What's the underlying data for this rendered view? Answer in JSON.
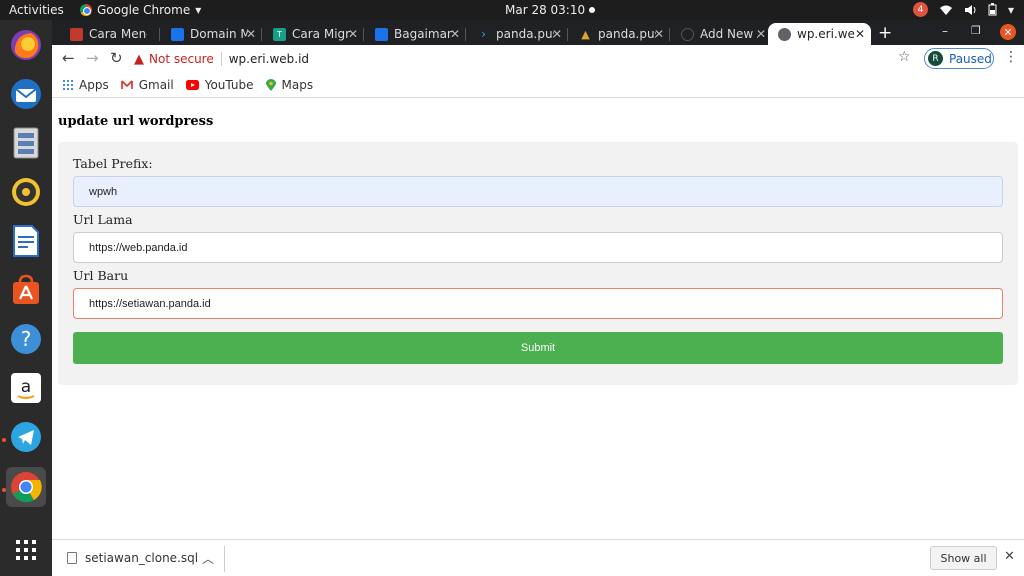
{
  "topbar": {
    "activities": "Activities",
    "app_name": "Google Chrome",
    "app_caret": "▾",
    "clock": "Mar 28  03:10",
    "notification_count": "4",
    "tray_caret": "▾"
  },
  "dock": {
    "items": [
      "firefox-icon",
      "thunderbird-icon",
      "files-icon",
      "rhythmbox-icon",
      "writer-icon",
      "software-icon",
      "help-icon",
      "amazon-icon",
      "telegram-icon",
      "chrome-icon",
      "app-grid-icon"
    ]
  },
  "tabs": [
    {
      "title": "Cara Meng",
      "favicon_color": "#c0392b"
    },
    {
      "title": "Domain M",
      "favicon_color": "#1a73e8"
    },
    {
      "title": "Cara Migra",
      "favicon_color": "#16a085"
    },
    {
      "title": "Bagaiman",
      "favicon_color": "#1a73e8"
    },
    {
      "title": "panda.pus",
      "favicon_color": "#29a8e0"
    },
    {
      "title": "panda.pus",
      "favicon_color": "#e0a030"
    },
    {
      "title": "Add New A",
      "favicon_color": "#555555"
    },
    {
      "title": "wp.eri.wel",
      "favicon_color": "#dddddd"
    }
  ],
  "toolbar": {
    "not_secure": "Not secure",
    "url": "wp.eri.web.id",
    "profile_initial": "R",
    "profile_status": "Paused"
  },
  "bookmarks": {
    "apps": "Apps",
    "gmail": "Gmail",
    "youtube": "YouTube",
    "maps": "Maps"
  },
  "form": {
    "title": "update url wordpress",
    "prefix_label": "Tabel Prefix:",
    "prefix_value": "wpwh",
    "old_label": "Url Lama",
    "old_value": "https://web.panda.id",
    "new_label": "Url Baru",
    "new_value": "https://setiawan.panda.id",
    "submit_label": "Submit"
  },
  "download": {
    "filename": "setiawan_clone.sql",
    "show_all": "Show all"
  },
  "colors": {
    "accent_orange": "#e95420",
    "submit_green": "#4caf50",
    "warning_red": "#c5221f"
  }
}
